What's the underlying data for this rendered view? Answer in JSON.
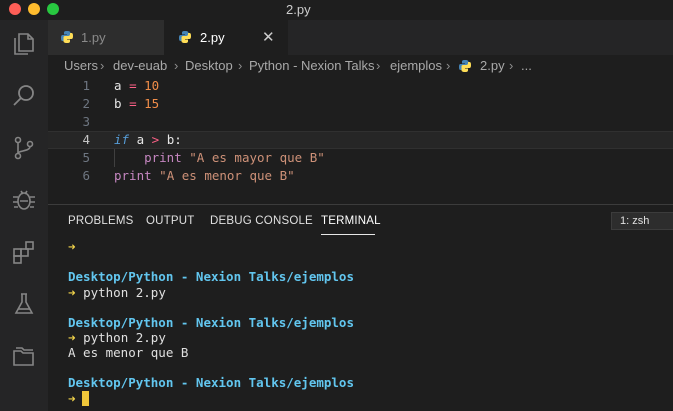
{
  "window": {
    "title": "2.py"
  },
  "tabs": [
    {
      "label": "1.py",
      "active": false
    },
    {
      "label": "2.py",
      "active": true,
      "close": "✕"
    }
  ],
  "breadcrumb": [
    "Users",
    "dev-euab",
    "Desktop",
    "Python - Nexion Talks",
    "ejemplos",
    "2.py",
    "..."
  ],
  "editor": {
    "lines": [
      {
        "n": "1",
        "text": "a = 10"
      },
      {
        "n": "2",
        "text": "b = 15"
      },
      {
        "n": "3",
        "text": ""
      },
      {
        "n": "4",
        "text": "if a > b:"
      },
      {
        "n": "5",
        "text": "    print \"A es mayor que B\""
      },
      {
        "n": "6",
        "text": "print \"A es menor que B\""
      }
    ]
  },
  "panel": {
    "tabs": [
      "PROBLEMS",
      "OUTPUT",
      "DEBUG CONSOLE",
      "TERMINAL"
    ],
    "active_tab": "TERMINAL",
    "shell_select": "1: zsh",
    "prompt_arrow": "➜",
    "terminal": [
      {
        "kind": "prompt",
        "text": ""
      },
      {
        "kind": "path",
        "text": "Desktop/Python - Nexion Talks/ejemplos"
      },
      {
        "kind": "prompt",
        "text": "python 2.py"
      },
      {
        "kind": "path",
        "text": "Desktop/Python - Nexion Talks/ejemplos"
      },
      {
        "kind": "prompt",
        "text": "python 2.py"
      },
      {
        "kind": "output",
        "text": "A es menor que B"
      },
      {
        "kind": "path",
        "text": "Desktop/Python - Nexion Talks/ejemplos"
      },
      {
        "kind": "prompt",
        "text": ""
      }
    ]
  },
  "colors": {
    "keyword": "#569cd6",
    "number": "#f08d49",
    "string": "#ce9178",
    "path": "#62c6ef",
    "prompt": "#f0d24a",
    "cursor": "#f0c63a"
  }
}
